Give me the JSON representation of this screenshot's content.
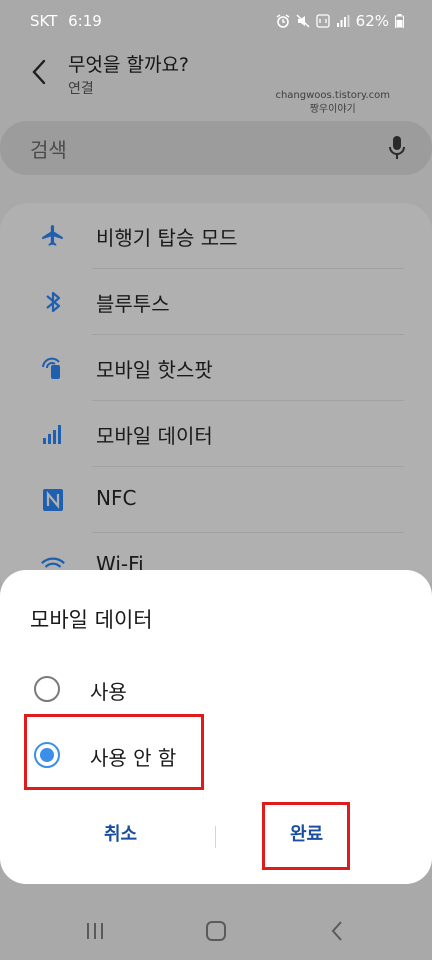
{
  "status": {
    "carrier": "SKT",
    "time": "6:19",
    "battery": "62%"
  },
  "header": {
    "title": "무엇을 할까요?",
    "subtitle": "연결"
  },
  "watermark": {
    "line1": "changwoos.tistory.com",
    "line2": "짱우이야기"
  },
  "search": {
    "placeholder": "검색"
  },
  "list": {
    "items": [
      {
        "label": "비행기 탑승 모드",
        "icon": "airplane-icon"
      },
      {
        "label": "블루투스",
        "icon": "bluetooth-icon"
      },
      {
        "label": "모바일 핫스팟",
        "icon": "hotspot-icon"
      },
      {
        "label": "모바일 데이터",
        "icon": "signal-bars-icon"
      },
      {
        "label": "NFC",
        "icon": "nfc-icon"
      },
      {
        "label": "Wi-Fi",
        "icon": "wifi-icon"
      }
    ]
  },
  "dialog": {
    "title": "모바일 데이터",
    "options": [
      {
        "label": "사용",
        "selected": false
      },
      {
        "label": "사용 안 함",
        "selected": true
      }
    ],
    "cancel_label": "취소",
    "done_label": "완료"
  },
  "colors": {
    "accent": "#3b8fe8",
    "highlight": "#e01b1b",
    "icon_blue": "#1f5fb0"
  }
}
